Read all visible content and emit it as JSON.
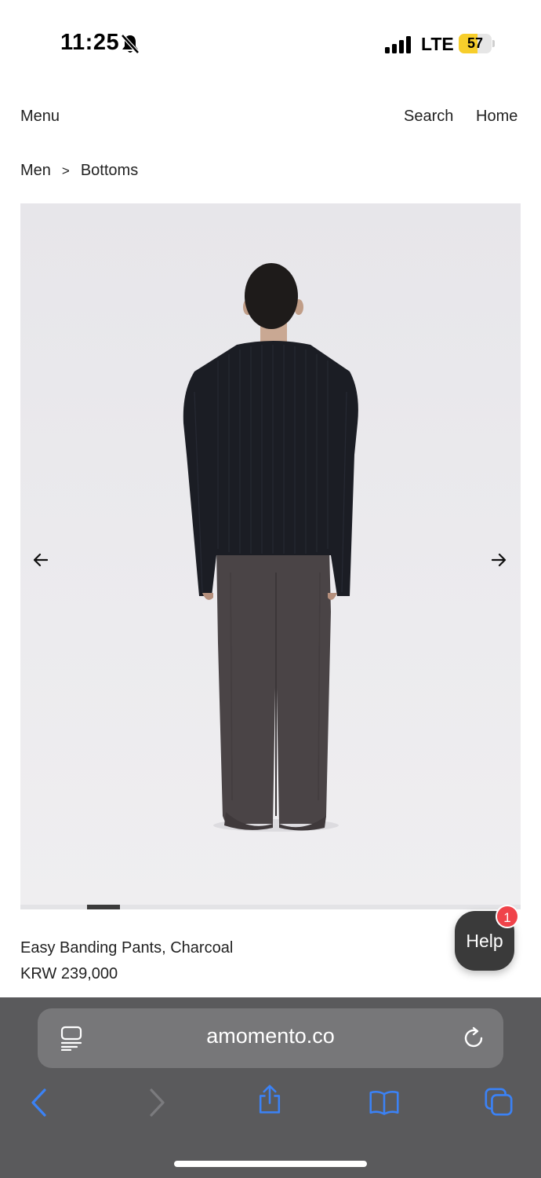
{
  "status_bar": {
    "time": "11:25",
    "network": "LTE",
    "battery_level": "57",
    "battery_fraction": 0.57,
    "icons": [
      "bell-muted-icon",
      "signal-icon",
      "battery-icon"
    ]
  },
  "header": {
    "menu_label": "Menu",
    "search_label": "Search",
    "home_label": "Home"
  },
  "breadcrumb": {
    "items": [
      "Men",
      "Bottoms"
    ],
    "separator": ">"
  },
  "gallery": {
    "image_description_icon": "product-photo",
    "prev_icon": "arrow-left-icon",
    "next_icon": "arrow-right-icon",
    "active_slide_index": 1
  },
  "product": {
    "name": "Easy Banding Pants, Charcoal",
    "price": "KRW 239,000"
  },
  "help_widget": {
    "label": "Help",
    "badge_count": "1"
  },
  "browser": {
    "url": "amomento.co",
    "icons": [
      "reader-icon",
      "reload-icon",
      "back-icon",
      "forward-icon",
      "share-icon",
      "bookmarks-icon",
      "tabs-icon"
    ],
    "accent_color": "#3b82f6"
  }
}
